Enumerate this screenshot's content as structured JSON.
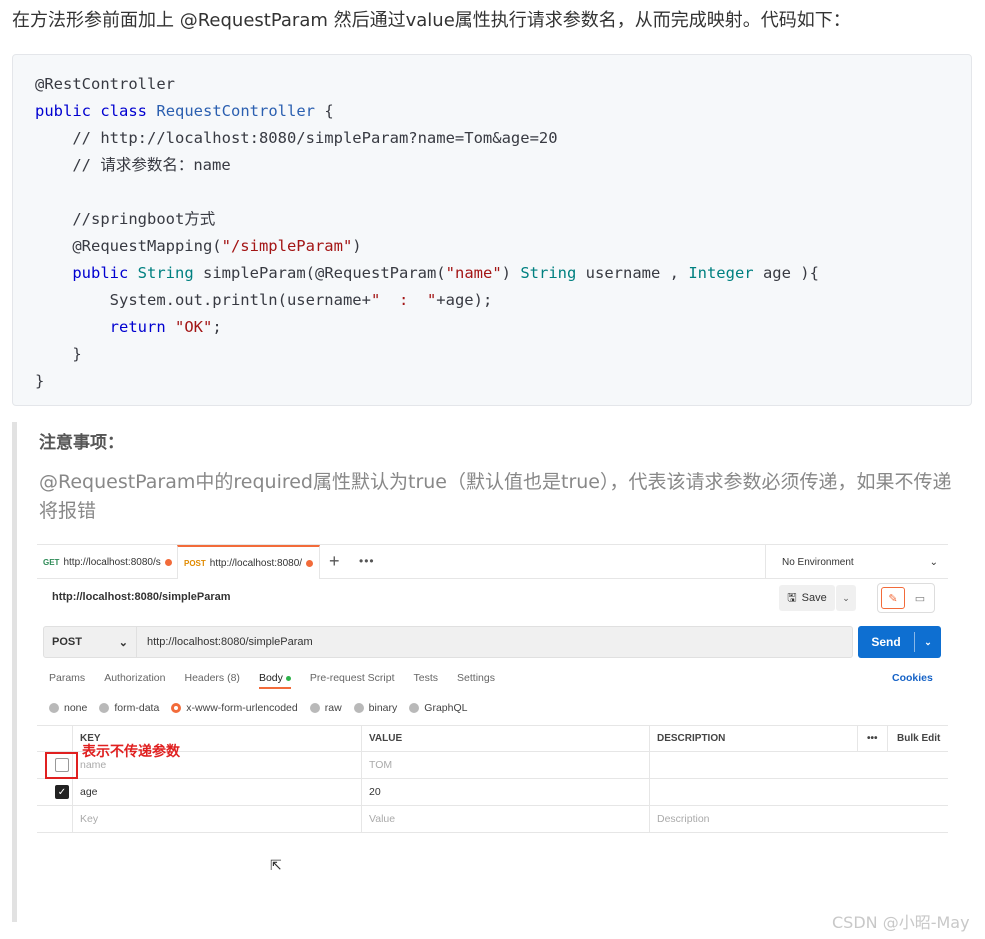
{
  "intro": "在方法形参前面加上 @RequestParam 然后通过value属性执行请求参数名，从而完成映射。代码如下：",
  "code": {
    "line1": "@RestController",
    "kw_public": "public",
    "kw_class": "class",
    "class_name": "RequestController",
    "brace_open": " {",
    "comment1": "    // http://localhost:8080/simpleParam?name=Tom&age=20",
    "comment2": "    // 请求参数名：name",
    "comment3": "    //springboot方式",
    "mapping_prefix": "    @RequestMapping(",
    "mapping_str": "\"/simpleParam\"",
    "mapping_suffix": ")",
    "indent4": "    ",
    "m_public": "public",
    "m_string": "String",
    "m_name": "simpleParam(@RequestParam(",
    "m_name_str": "\"name\"",
    "m_close": ") ",
    "m_string2": "String",
    "m_username": " username , ",
    "m_integer": "Integer",
    "m_age": " age ){",
    "print_prefix": "        System.out.println(username+",
    "print_str": "\"  :  \"",
    "print_suffix": "+age);",
    "ret_kw": "        return",
    "ret_str": "\"OK\"",
    "ret_suffix": ";",
    "inner_close": "    }",
    "outer_close": "}"
  },
  "note": {
    "title": "注意事项：",
    "text": "@RequestParam中的required属性默认为true（默认值也是true），代表该请求参数必须传递，如果不传递将报错"
  },
  "postman": {
    "tab1": {
      "method": "GET",
      "url": "http://localhost:8080/s"
    },
    "tab2": {
      "method": "POST",
      "url": "http://localhost:8080/"
    },
    "plus": "+",
    "more": "•••",
    "environment": "No Environment",
    "request_title": "http://localhost:8080/simpleParam",
    "save": "Save",
    "method": "POST",
    "url": "http://localhost:8080/simpleParam",
    "send": "Send",
    "subtabs": [
      "Params",
      "Authorization",
      "Headers (8)",
      "Body",
      "Pre-request Script",
      "Tests",
      "Settings"
    ],
    "cookies": "Cookies",
    "body_types": [
      "none",
      "form-data",
      "x-www-form-urlencoded",
      "raw",
      "binary",
      "GraphQL"
    ],
    "columns": {
      "key": "KEY",
      "value": "VALUE",
      "description": "DESCRIPTION",
      "more": "•••",
      "bulk": "Bulk Edit"
    },
    "rows": [
      {
        "checked": false,
        "key": "name",
        "value": "TOM",
        "description": ""
      },
      {
        "checked": true,
        "key": "age",
        "value": "20",
        "description": ""
      }
    ],
    "placeholder": {
      "key": "Key",
      "value": "Value",
      "description": "Description"
    },
    "annotation": "表示不传递参数",
    "accent_color": "#f26b3a",
    "send_color": "#0e6fd1"
  },
  "watermark": "CSDN @小昭-May"
}
